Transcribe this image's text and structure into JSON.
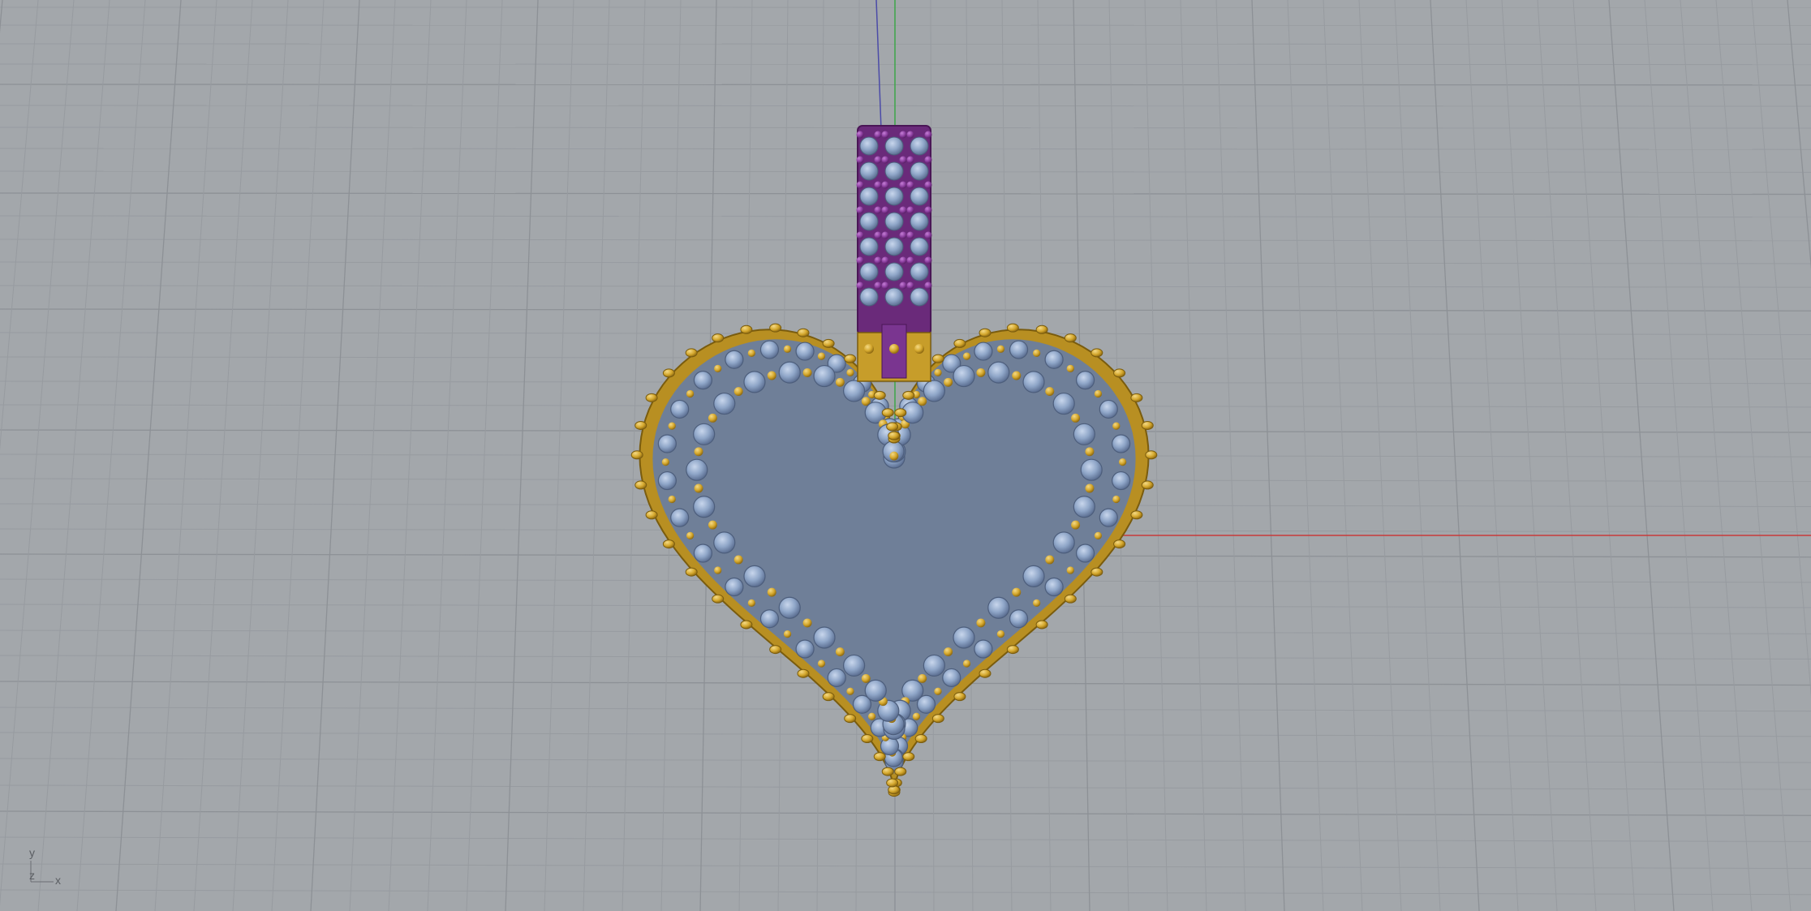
{
  "viewport": {
    "background": "#a3a7ab",
    "grid_minor_color": "#979ba0",
    "grid_major_color": "#8d9196",
    "x_axis_color": "#c83a3a",
    "y_axis_color": "#3fa84b",
    "z_axis_color": "#4b4ba8"
  },
  "model": {
    "name": "heart-pendant",
    "metal_color": "#d4a72c",
    "gem_color": "#8fa6c8",
    "bail_color": "#8c3fa0",
    "inner_bar_color": "#3f9a6e"
  },
  "axis_indicator": {
    "y_label": "y",
    "z_label": "z",
    "x_label": "x"
  }
}
